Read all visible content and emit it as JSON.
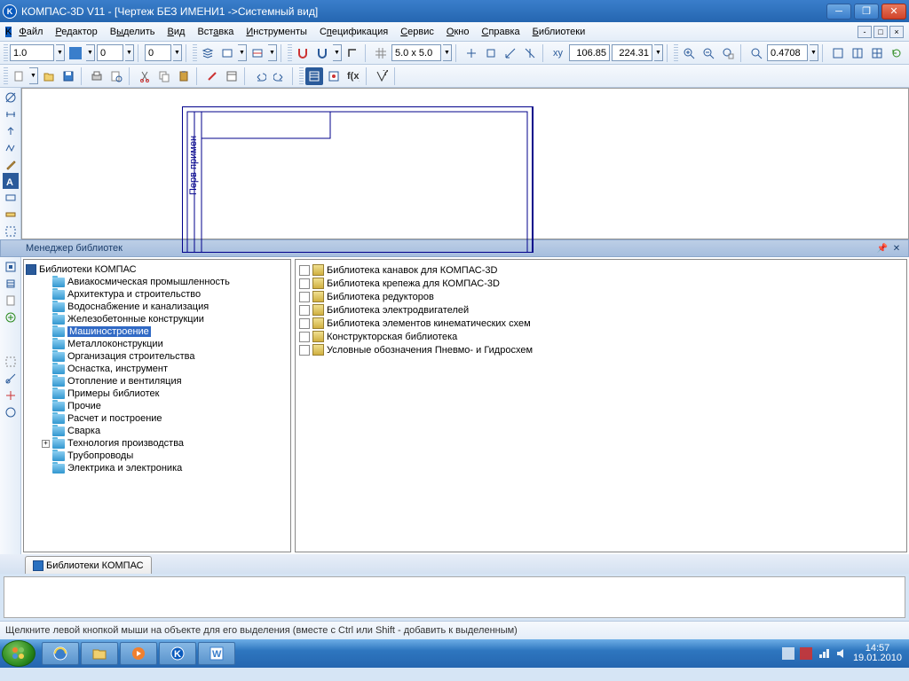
{
  "title": "КОМПАС-3D V11 - [Чертеж БЕЗ ИМЕНИ1 ->Системный вид]",
  "menu": [
    "Файл",
    "Редактор",
    "Выделить",
    "Вид",
    "Вставка",
    "Инструменты",
    "Спецификация",
    "Сервис",
    "Окно",
    "Справка",
    "Библиотеки"
  ],
  "tb1": {
    "scale": "1.0",
    "step": "0",
    "layer": "0"
  },
  "tb2": {
    "grid": "5.0 x 5.0",
    "x": "106.85",
    "y": "224.31",
    "zoom": "0.4708"
  },
  "libmgr": {
    "title": "Менеджер библиотек",
    "root": "Библиотеки КОМПАС",
    "folders": [
      "Авиакосмическая промышленность",
      "Архитектура и строительство",
      "Водоснабжение и канализация",
      "Железобетонные конструкции",
      "Машиностроение",
      "Металлоконструкции",
      "Организация строительства",
      "Оснастка, инструмент",
      "Отопление и вентиляция",
      "Примеры библиотек",
      "Прочие",
      "Расчет и построение",
      "Сварка",
      "Технология производства",
      "Трубопроводы",
      "Электрика и электроника"
    ],
    "selected": 4,
    "items": [
      "Библиотека канавок для КОМПАС-3D",
      "Библиотека крепежа для КОМПАС-3D",
      "Библиотека редукторов",
      "Библиотека электродвигателей",
      "Библиотека элементов кинематических схем",
      "Конструкторская библиотека",
      "Условные обозначения Пневмо- и Гидросхем"
    ]
  },
  "tab": "Библиотеки КОМПАС",
  "status": "Щелкните левой кнопкой мыши на объекте для его выделения (вместе с Ctrl или Shift - добавить к выделенным)",
  "clock": {
    "time": "14:57",
    "date": "19.01.2010"
  }
}
